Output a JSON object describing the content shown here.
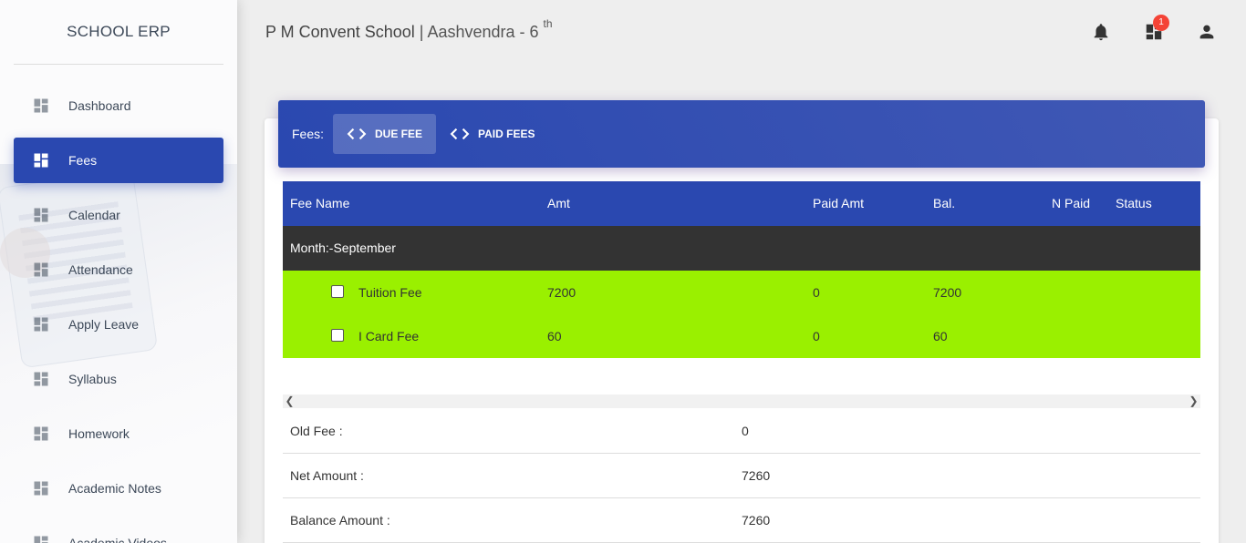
{
  "app": {
    "title": "SCHOOL ERP"
  },
  "sidebar": {
    "items": [
      {
        "label": "Dashboard",
        "icon": "dashboard-icon",
        "active": false
      },
      {
        "label": "Fees",
        "icon": "dashboard-icon",
        "active": true
      },
      {
        "label": "Calendar",
        "icon": "dashboard-icon",
        "active": false
      },
      {
        "label": "Attendance",
        "icon": "dashboard-icon",
        "active": false
      },
      {
        "label": "Apply Leave",
        "icon": "dashboard-icon",
        "active": false
      },
      {
        "label": "Syllabus",
        "icon": "dashboard-icon",
        "active": false
      },
      {
        "label": "Homework",
        "icon": "dashboard-icon",
        "active": false
      },
      {
        "label": "Academic Notes",
        "icon": "dashboard-icon",
        "active": false
      },
      {
        "label": "Academic Videos",
        "icon": "dashboard-icon",
        "active": false
      }
    ]
  },
  "header": {
    "school_name": "P M Convent School",
    "separator": " | ",
    "student": "Aashvendra - 6",
    "class_suffix": "th",
    "notifications_badge": "1",
    "icons": [
      "bell-icon",
      "dashboard-icon",
      "person-icon"
    ]
  },
  "fees": {
    "label": "Fees:",
    "tabs": [
      {
        "label": "DUE FEE",
        "active": true
      },
      {
        "label": "PAID FEES",
        "active": false
      }
    ],
    "columns": [
      "Fee Name",
      "Amt",
      "Paid Amt",
      "Bal.",
      "N Paid",
      "Status"
    ],
    "month_label": "Month:-September",
    "rows": [
      {
        "name": "Tuition Fee",
        "amt": "7200",
        "paid": "0",
        "bal": "7200",
        "n_paid": "",
        "status": ""
      },
      {
        "name": "I Card Fee",
        "amt": "60",
        "paid": "0",
        "bal": "60",
        "n_paid": "",
        "status": ""
      }
    ],
    "summary": [
      {
        "label": "Old Fee :",
        "value": "0"
      },
      {
        "label": "Net Amount :",
        "value": "7260"
      },
      {
        "label": "Balance Amount :",
        "value": "7260"
      }
    ]
  },
  "colors": {
    "primary": "#2a48b0",
    "month_row": "#333333",
    "due_row": "#9af000",
    "badge": "#f44336"
  }
}
